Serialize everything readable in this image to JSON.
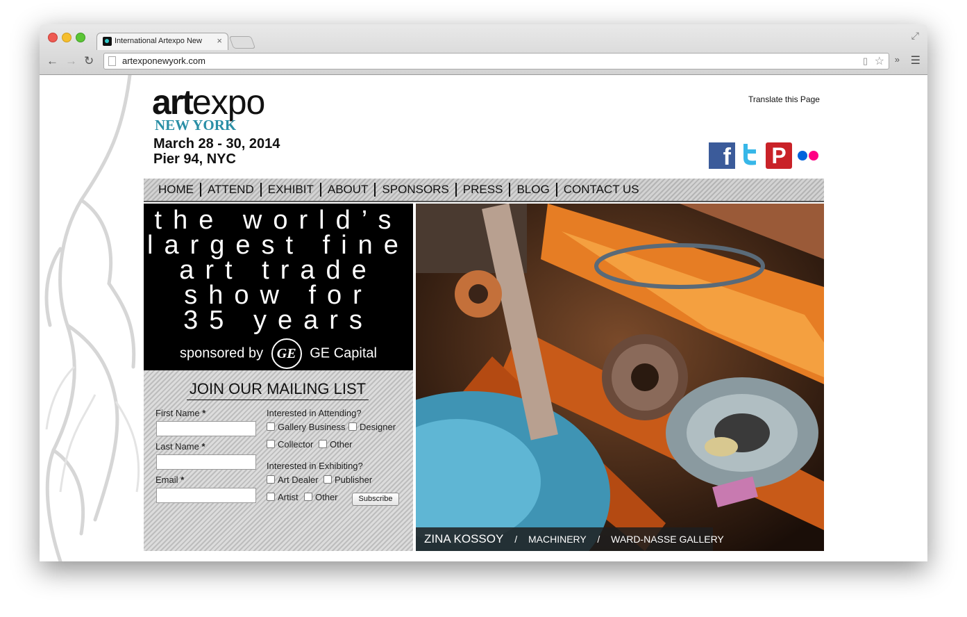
{
  "browser": {
    "tab_title": "International Artexpo New",
    "tab_close": "×",
    "url": "artexponewyork.com",
    "back": "←",
    "forward": "→",
    "reload": "↻",
    "extensions": "»",
    "menu": "☰",
    "star": "☆"
  },
  "logo": {
    "art": "art",
    "expo": "expo",
    "city": "NEW YORK"
  },
  "event": {
    "dates": "March 28 - 30, 2014",
    "venue": "Pier 94, NYC"
  },
  "translate": "Translate this Page",
  "social": {
    "facebook": "f",
    "pinterest": "P",
    "colors": {
      "facebook": "#3b5b9a",
      "twitter": "#37b7e8",
      "pinterest": "#c92228",
      "flickr_blue": "#0063dc",
      "flickr_pink": "#ff0084"
    }
  },
  "nav": [
    "HOME",
    "ATTEND",
    "EXHIBIT",
    "ABOUT",
    "SPONSORS",
    "PRESS",
    "BLOG",
    "CONTACT US"
  ],
  "tagline": {
    "lines": [
      "the world’s",
      "largest fine",
      "art trade",
      "show for",
      "35 years"
    ],
    "sponsored_by": "sponsored by",
    "ge_mark": "GE",
    "sponsor": "GE Capital"
  },
  "mailing": {
    "title": "JOIN OUR MAILING LIST",
    "first_name": "First Name",
    "last_name": "Last Name",
    "email": "Email",
    "required": "*",
    "attending_label": "Interested in Attending?",
    "attending_options": [
      "Gallery Business",
      "Designer",
      "Collector",
      "Other"
    ],
    "exhibiting_label": "Interested in Exhibiting?",
    "exhibiting_options": [
      "Art Dealer",
      "Publisher",
      "Artist",
      "Other"
    ],
    "subscribe": "Subscribe"
  },
  "hero": {
    "artist": "ZINA KOSSOY",
    "separator": "/",
    "work": "MACHINERY",
    "gallery": "WARD-NASSE GALLERY"
  }
}
